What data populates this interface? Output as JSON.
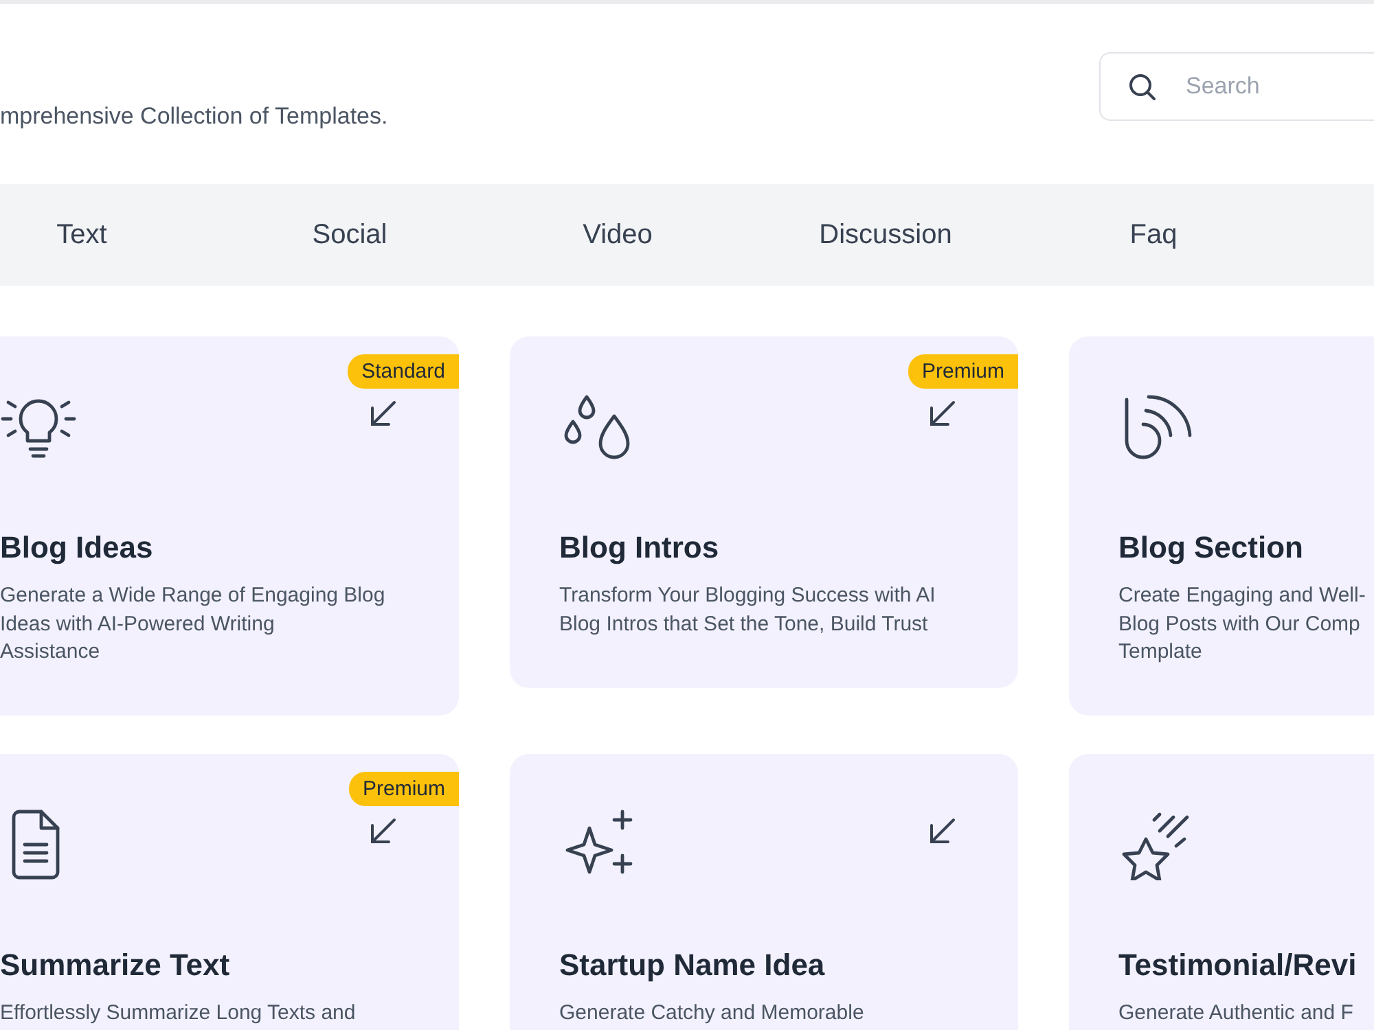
{
  "header": {
    "subtitle": "mprehensive Collection of Templates.",
    "search": {
      "placeholder": "Search"
    }
  },
  "tabs": [
    {
      "label": "Text",
      "selected": false
    },
    {
      "label": "Social",
      "selected": false
    },
    {
      "label": "Video",
      "selected": false
    },
    {
      "label": "Discussion",
      "selected": false
    },
    {
      "label": "Faq",
      "selected": false
    }
  ],
  "cards": [
    {
      "title": "Blog Ideas",
      "badge": "Standard",
      "arrow": true,
      "description": [
        "Generate a Wide Range of Engaging Blog",
        "Ideas with AI-Powered Writing",
        "Assistance"
      ]
    },
    {
      "title": "Blog Intros",
      "badge": "Premium",
      "arrow": true,
      "description": [
        "Transform Your Blogging Success with AI",
        "Blog Intros that Set the Tone, Build Trust"
      ]
    },
    {
      "title": "Blog Section",
      "description": [
        "Create Engaging and Well-",
        "Blog Posts with Our Comp",
        "Template"
      ]
    },
    {
      "title": "Summarize Text",
      "badge": "Premium",
      "arrow": true,
      "description": [
        "Effortlessly Summarize Long Texts and"
      ]
    },
    {
      "title": "Startup Name Idea",
      "arrow": true,
      "description": [
        "Generate Catchy and Memorable"
      ]
    },
    {
      "title": "Testimonial/Revi",
      "description": [
        "Generate Authentic and F"
      ]
    }
  ]
}
